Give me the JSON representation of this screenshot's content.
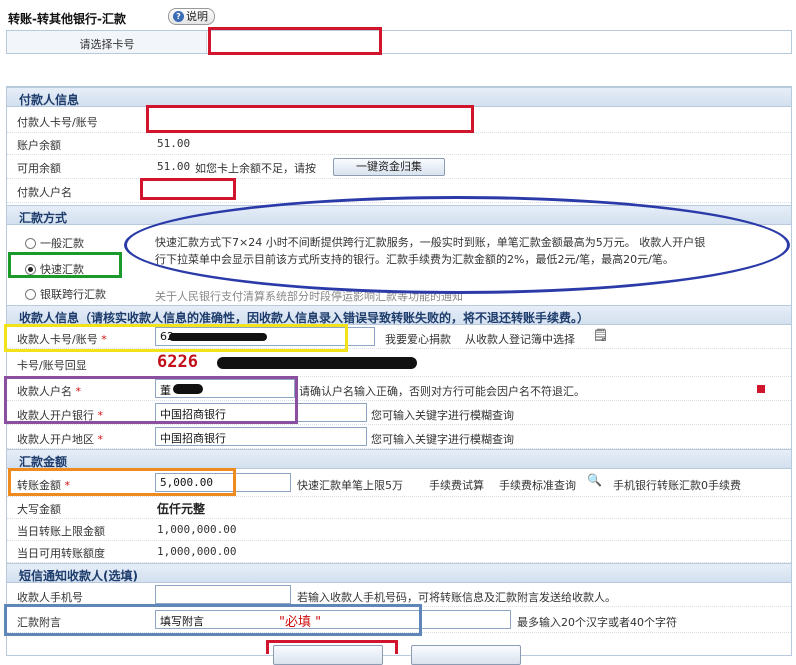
{
  "page": {
    "title": "转账-转其他银行-汇款",
    "help_label": "说明",
    "select_card_label": "请选择卡号"
  },
  "payer": {
    "section": "付款人信息",
    "card_label": "付款人卡号/账号",
    "balance_label": "账户余额",
    "balance": "51.00",
    "available_label": "可用余额",
    "available": "51.00",
    "insufficient_note": "如您卡上余额不足，请按",
    "collect_button": "一键资金归集",
    "name_label": "付款人户名"
  },
  "method": {
    "section": "汇款方式",
    "options": [
      "一般汇款",
      "快速汇款",
      "银联跨行汇款"
    ],
    "selected": "快速汇款",
    "desc_line1": "快速汇款方式下7×24 小时不间断提供跨行汇款服务，一般实时到账，单笔汇款金额最高为5万元。 收款人开户银",
    "desc_line2": "行下拉菜单中会显示目前该方式所支持的银行。汇款手续费为汇款金额的2%，最低2元/笔，最高20元/笔。",
    "unionpay_note": "关于人民银行支付清算系统部分时段停运影响汇款等功能的通知"
  },
  "payee": {
    "section": "收款人信息（请核实收款人信息的准确性，因收款人信息录入错误导致转账失败的，将不退还转账手续费。）",
    "card_label": "收款人卡号/账号",
    "required_mark": "*",
    "card_value": "62",
    "donate_link": "我要爱心捐款",
    "select_from_book": "从收款人登记簿中选择",
    "echo_label": "卡号/账号回显",
    "echo_value": "6226",
    "name_label": "收款人户名",
    "name_value": "董",
    "name_hint": "请确认户名输入正确，否则对方行可能会因户名不符退汇。",
    "bank_label": "收款人开户银行",
    "bank_value": "中国招商银行",
    "bank_hint": "您可输入关键字进行模糊查询",
    "region_label": "收款人开户地区",
    "region_value": "中国招商银行",
    "region_hint": "您可输入关键字进行模糊查询"
  },
  "amount": {
    "section": "汇款金额",
    "amount_label": "转账金额",
    "amount_value": "5,000.00",
    "limit_note": "快速汇款单笔上限5万",
    "fee_trial": "手续费试算",
    "fee_standard": "手续费标准查询",
    "mobile_note": "手机银行转账汇款0手续费",
    "uppercase_label": "大写金额",
    "uppercase_value": "伍仟元整",
    "daily_limit_label": "当日转账上限金额",
    "daily_limit": "1,000,000.00",
    "daily_available_label": "当日可用转账额度",
    "daily_available": "1,000,000.00"
  },
  "sms": {
    "section": "短信通知收款人(选填)",
    "phone_label": "收款人手机号",
    "phone_hint": "若输入收款人手机号码，可将转账信息及汇款附言发送给收款人。",
    "memo_label": "汇款附言",
    "memo_value": "填写附言",
    "memo_required": "\"必填 \"",
    "memo_hint": "最多输入20个汉字或者40个字符"
  },
  "colors": {
    "highlight_red": "#d0152c",
    "highlight_blue": "#2a3aa8",
    "highlight_green": "#1a9a2a",
    "highlight_yellow": "#f2e21a",
    "highlight_purple": "#8a4f9e",
    "highlight_orange": "#ee8a1e",
    "highlight_steel": "#5f86b8"
  }
}
